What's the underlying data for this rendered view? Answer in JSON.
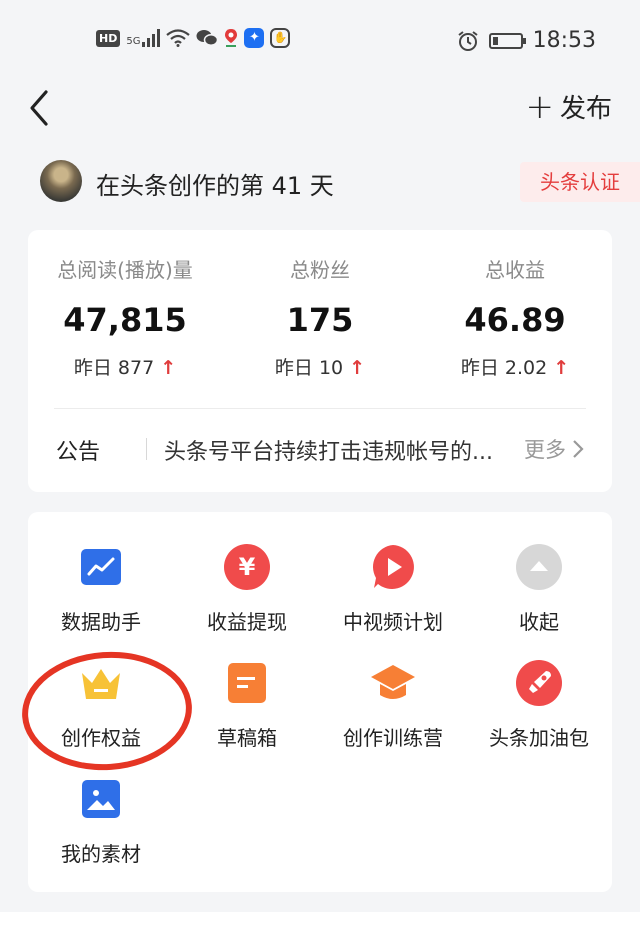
{
  "status_bar": {
    "time": "18:53",
    "network": "5G",
    "hd_label": "HD",
    "icons": [
      "hd-icon",
      "signal-icon",
      "wifi-icon",
      "wechat-icon",
      "location-icon",
      "bulb-icon",
      "hand-icon",
      "alarm-icon",
      "battery-icon"
    ],
    "battery_level": 0.2
  },
  "header": {
    "back_icon": "chevron-left-icon",
    "publish_label": "发布"
  },
  "profile": {
    "days_text": "在头条创作的第 41 天",
    "cert_label": "头条认证"
  },
  "stats": [
    {
      "label": "总阅读(播放)量",
      "value": "47,815",
      "yesterday": "昨日 877"
    },
    {
      "label": "总粉丝",
      "value": "175",
      "yesterday": "昨日 10"
    },
    {
      "label": "总收益",
      "value": "46.89",
      "yesterday": "昨日 2.02"
    }
  ],
  "notice": {
    "tag": "公告",
    "text": "头条号平台持续打击违规帐号的...",
    "more": "更多"
  },
  "tools": [
    {
      "name": "数据助手",
      "icon": "chart-icon",
      "color": "#2f6fe8"
    },
    {
      "name": "收益提现",
      "icon": "yuan-icon",
      "color": "#f04b4b"
    },
    {
      "name": "中视频计划",
      "icon": "play-icon",
      "color": "#f04b4b"
    },
    {
      "name": "收起",
      "icon": "collapse-icon",
      "color": "#d7d7d7"
    },
    {
      "name": "创作权益",
      "icon": "crown-icon",
      "color": "#f7c237"
    },
    {
      "name": "草稿箱",
      "icon": "draft-icon",
      "color": "#f77f35"
    },
    {
      "name": "创作训练营",
      "icon": "graduation-cap-icon",
      "color": "#f77f35"
    },
    {
      "name": "头条加油包",
      "icon": "rocket-icon",
      "color": "#f04b4b"
    },
    {
      "name": "我的素材",
      "icon": "image-icon",
      "color": "#2f6fe8"
    }
  ],
  "colors": {
    "accent_red": "#e03c3c",
    "annotation": "#e53524"
  }
}
